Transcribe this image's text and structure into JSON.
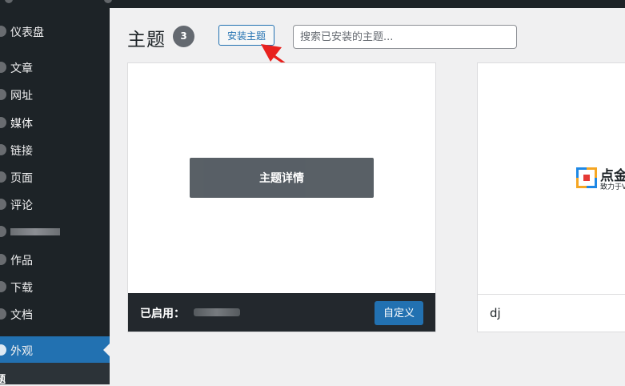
{
  "sidebar": {
    "items": [
      {
        "label": "仪表盘"
      },
      {
        "label": "文章"
      },
      {
        "label": "网址"
      },
      {
        "label": "媒体"
      },
      {
        "label": "链接"
      },
      {
        "label": "页面"
      },
      {
        "label": "评论"
      },
      {
        "label": ""
      },
      {
        "label": "作品"
      },
      {
        "label": "下载"
      },
      {
        "label": "文档"
      },
      {
        "label": "外观"
      }
    ],
    "active_item": "外观",
    "submenu_label": "题"
  },
  "header": {
    "title": "主题",
    "count": "3",
    "install_button": "安装主题",
    "search_placeholder": "搜索已安装的主题..."
  },
  "themes": [
    {
      "details_button": "主题详情",
      "active_label": "已启用：",
      "customize_button": "自定义"
    },
    {
      "name": "dj",
      "logo_title": "点金",
      "logo_sub": "致力于V"
    }
  ],
  "colors": {
    "sidebar_bg": "#1d2327",
    "accent": "#2271b1",
    "annotation_arrow": "#e8211e"
  }
}
